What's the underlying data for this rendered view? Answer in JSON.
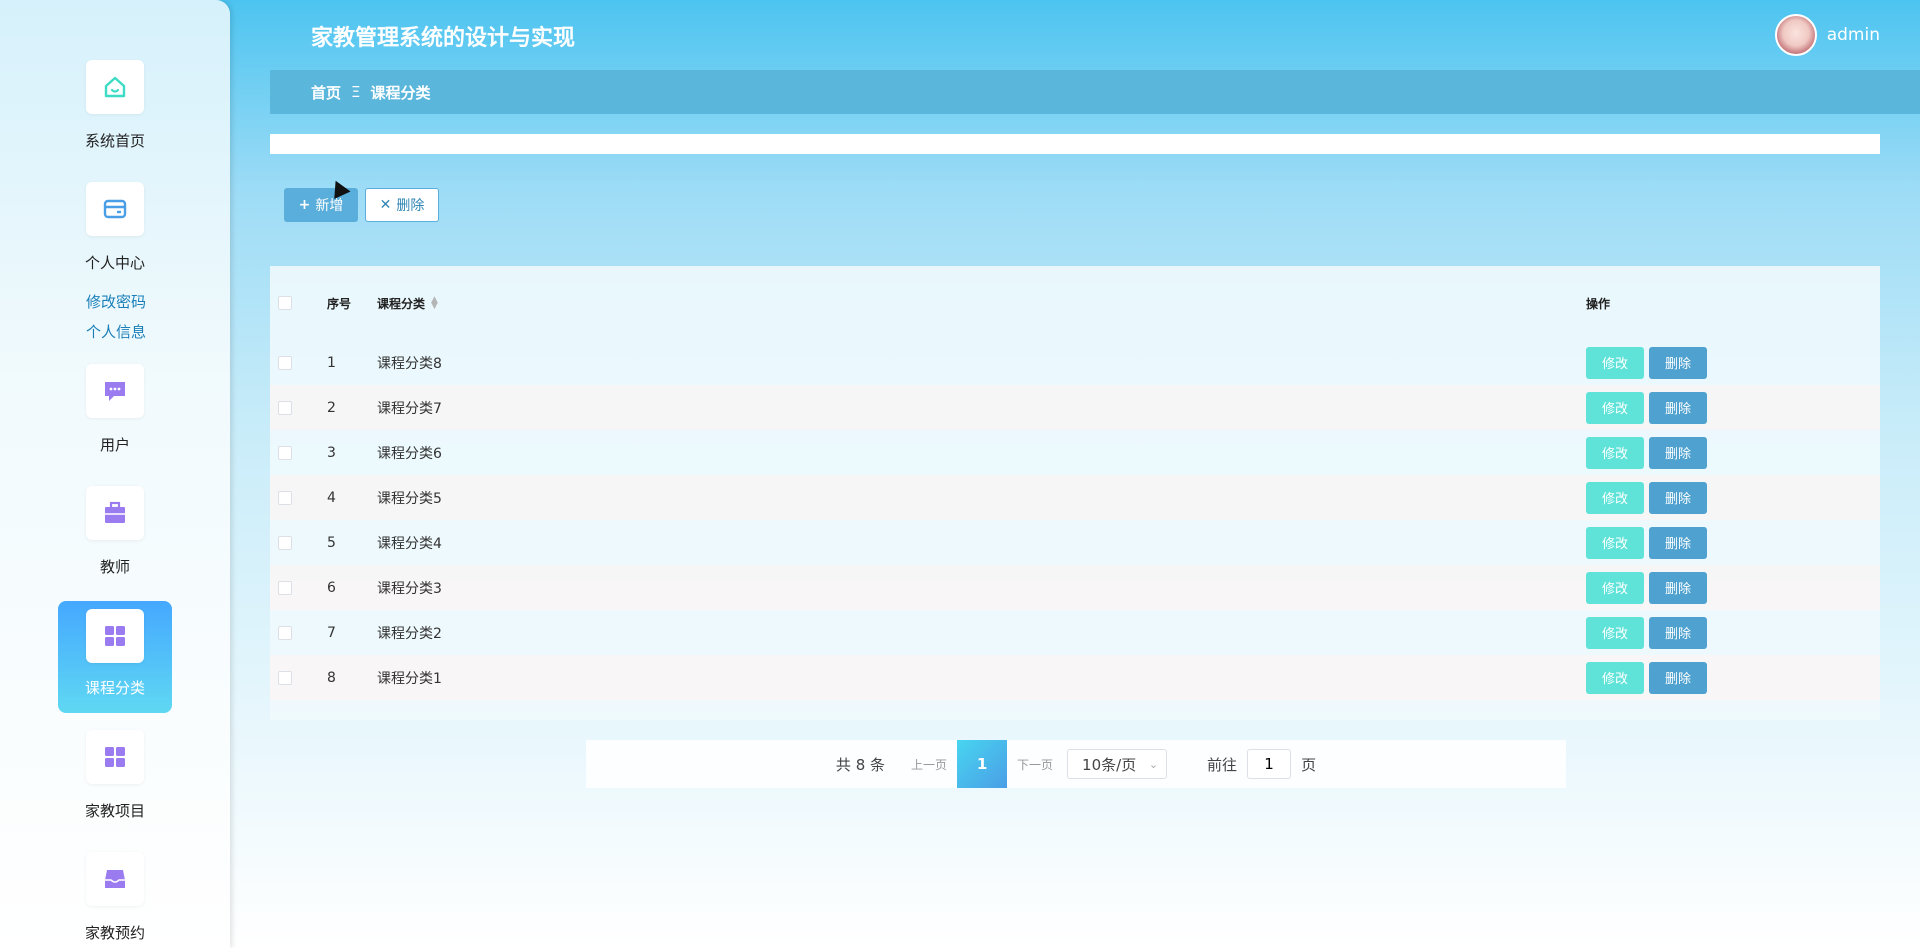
{
  "app": {
    "title": "家教管理系统的设计与实现",
    "username": "admin"
  },
  "sidebar": {
    "items": [
      {
        "label": "系统首页",
        "icon": "home-icon"
      },
      {
        "label": "个人中心",
        "icon": "card-icon"
      },
      {
        "label": "用户",
        "icon": "chat-icon"
      },
      {
        "label": "教师",
        "icon": "briefcase-icon"
      },
      {
        "label": "课程分类",
        "icon": "grid-icon"
      },
      {
        "label": "家教项目",
        "icon": "grid-icon"
      },
      {
        "label": "家教预约",
        "icon": "inbox-icon"
      }
    ],
    "sublinks": [
      "修改密码",
      "个人信息"
    ],
    "active": "课程分类"
  },
  "breadcrumb": {
    "home": "首页",
    "separator": "Ξ",
    "current": "课程分类"
  },
  "toolbar": {
    "add_label": "新增",
    "delete_label": "删除"
  },
  "table": {
    "headers": {
      "seq": "序号",
      "name": "课程分类",
      "ops": "操作"
    },
    "rows": [
      {
        "seq": "1",
        "name": "课程分类8"
      },
      {
        "seq": "2",
        "name": "课程分类7"
      },
      {
        "seq": "3",
        "name": "课程分类6"
      },
      {
        "seq": "4",
        "name": "课程分类5"
      },
      {
        "seq": "5",
        "name": "课程分类4"
      },
      {
        "seq": "6",
        "name": "课程分类3"
      },
      {
        "seq": "7",
        "name": "课程分类2"
      },
      {
        "seq": "8",
        "name": "课程分类1"
      }
    ],
    "edit_label": "修改",
    "delete_label": "删除"
  },
  "pagination": {
    "total": "共 8 条",
    "prev": "上一页",
    "current": "1",
    "next": "下一页",
    "page_size": "10条/页",
    "goto_prefix": "前往",
    "goto_value": "1",
    "goto_suffix": "页"
  },
  "colors": {
    "accent": "#5aaedb",
    "edit": "#5fe3d8",
    "delete": "#4fa2cf",
    "header_bg": "#4cc4f0"
  }
}
